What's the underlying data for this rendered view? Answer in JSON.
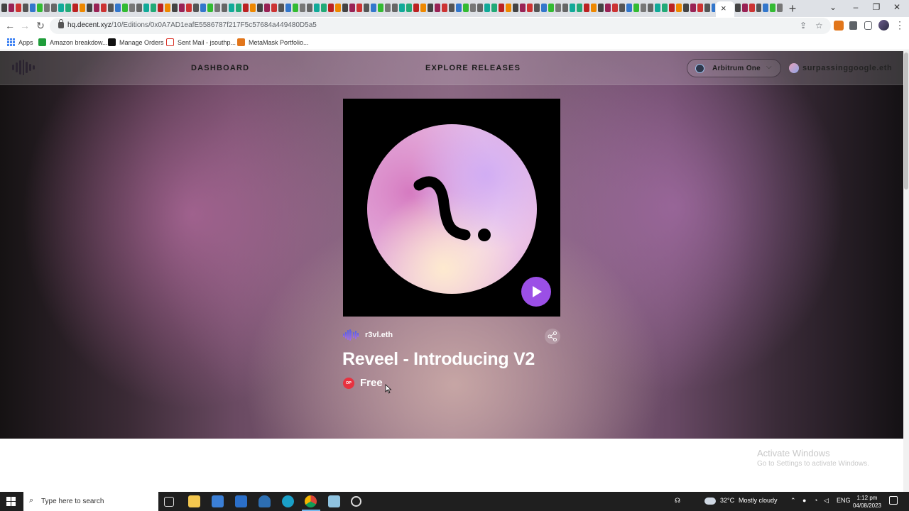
{
  "browser": {
    "url_host": "hq.decent.xyz",
    "url_path": "/10/Editions/0x0A7AD1eafE5586787f217F5c57684a449480D5a5",
    "close_tab_glyph": "×",
    "new_tab_glyph": "+",
    "window_controls": [
      "⌄",
      "–",
      "❐",
      "✕"
    ]
  },
  "bookmarks": [
    {
      "label": "Apps",
      "icon": "apps-grid-icon"
    },
    {
      "label": "Amazon breakdow...",
      "icon": "green-plus-icon",
      "color": "#1f9d3a"
    },
    {
      "label": "Manage Orders",
      "icon": "amazon-icon",
      "color": "#111111"
    },
    {
      "label": "Sent Mail - jsouthp...",
      "icon": "gmail-icon",
      "color": "#d93025"
    },
    {
      "label": "MetaMask Portfolio...",
      "icon": "metamask-icon",
      "color": "#e2761b"
    }
  ],
  "site": {
    "nav": {
      "dashboard": "DASHBOARD",
      "explore": "EXPLORE RELEASES",
      "network": "Arbitrum One",
      "account": "surpassinggoogle.eth"
    },
    "release": {
      "creator": "r3vl.eth",
      "title": "Reveel - Introducing V2",
      "chain_badge": "OP",
      "price": "Free"
    },
    "accent_color": "#9b4fe6"
  },
  "watermark": {
    "line1": "Activate Windows",
    "line2": "Go to Settings to activate Windows."
  },
  "taskbar": {
    "search_placeholder": "Type here to search",
    "weather_temp": "32°C",
    "weather_text": "Mostly cloudy",
    "language": "ENG",
    "time": "1:12 pm",
    "date": "04/08/2023"
  }
}
